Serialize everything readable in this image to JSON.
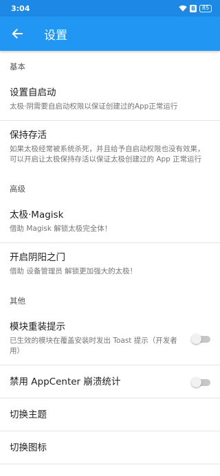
{
  "status": {
    "time": "3:04",
    "battery": "85",
    "bluetooth": "B"
  },
  "appbar": {
    "title": "设置",
    "back_icon": "arrow-left-icon"
  },
  "sections": {
    "basic": {
      "header": "基本",
      "items": [
        {
          "title": "设置自启动",
          "subtitle": "太极·阴需要自启动权限以保证创建过的App正常运行"
        },
        {
          "title": "保持存活",
          "subtitle": "如果太极经常被系统杀死，并且给予自启动权限也没有效果，可以开启让太极保持存活以保证太极创建过的 App 正常运行"
        }
      ]
    },
    "advanced": {
      "header": "高级",
      "items": [
        {
          "title": "太极·Magisk",
          "subtitle": "借助 Magisk 解锁太极完全体！"
        },
        {
          "title": "开启阴阳之门",
          "subtitle": "借助 设备管理员 解锁更加强大的太极！"
        }
      ]
    },
    "other": {
      "header": "其他",
      "items": [
        {
          "title": "模块重装提示",
          "subtitle": "已生效的模块在覆盖安装时发出 Toast 提示（开发者用）",
          "toggle": false
        },
        {
          "title": "禁用 AppCenter 崩溃统计",
          "toggle": false
        },
        {
          "title": "切换主题"
        },
        {
          "title": "切换图标"
        }
      ]
    }
  },
  "colors": {
    "statusbar": "#1e88e5",
    "appbar": "#2196f3",
    "divider": "#e4e4e4"
  }
}
